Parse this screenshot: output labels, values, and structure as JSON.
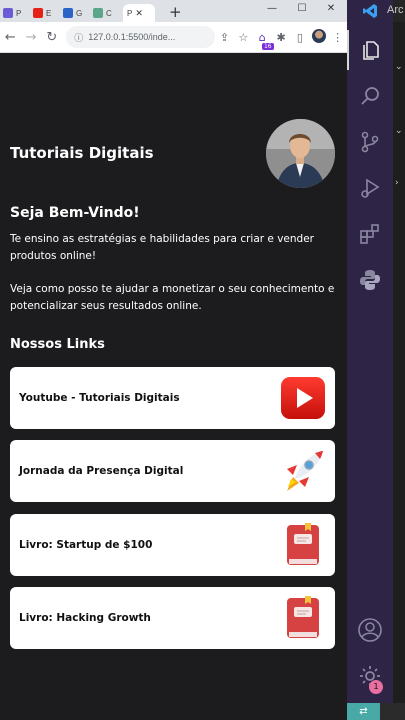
{
  "browser": {
    "tabs": [
      {
        "label": "P",
        "favicon_color": "#6b5bd6"
      },
      {
        "label": "E",
        "favicon_color": "#e62117"
      },
      {
        "label": "G",
        "favicon_color": "#2b64c8"
      },
      {
        "label": "C",
        "favicon_color": "#5aa68a"
      },
      {
        "label": "P",
        "favicon_color": "#8a8a8a"
      }
    ],
    "new_tab_label": "+",
    "url": "127.0.0.1:5500/inde...",
    "extension_badge": "16"
  },
  "page": {
    "title": "Tutoriais Digitais",
    "welcome": "Seja Bem-Vindo!",
    "paragraph1": "Te ensino as estratégias e habilidades para criar e vender produtos online!",
    "paragraph2": "Veja como posso te ajudar a monetizar o seu conhecimento e potencializar seus resultados online.",
    "links_heading": "Nossos Links",
    "links": [
      {
        "label": "Youtube - Tutoriais Digitais",
        "icon": "youtube-icon"
      },
      {
        "label": "Jornada da Presença Digital",
        "icon": "rocket-icon"
      },
      {
        "label": "Livro: Startup de $100",
        "icon": "book-icon"
      },
      {
        "label": "Livro: Hacking Growth",
        "icon": "book-icon"
      }
    ]
  },
  "vscode": {
    "title": "Arc",
    "notification_count": "1",
    "accent_color": "#2d2446"
  }
}
